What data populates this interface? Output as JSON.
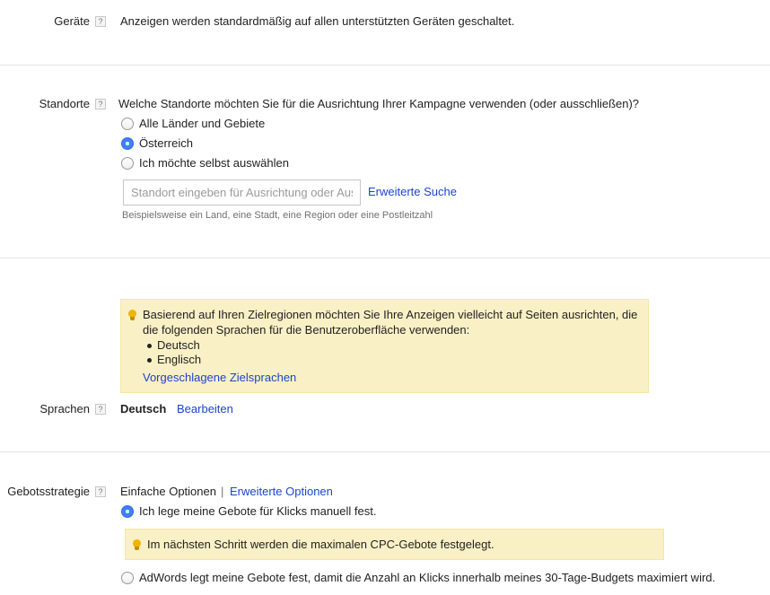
{
  "devices": {
    "label": "Geräte",
    "help": "?",
    "text": "Anzeigen werden standardmäßig auf allen unterstützten Geräten geschaltet."
  },
  "locations": {
    "label": "Standorte",
    "help": "?",
    "question": "Welche Standorte möchten Sie für die Ausrichtung Ihrer Kampagne verwenden (oder ausschließen)?",
    "options": [
      {
        "label": "Alle Länder und Gebiete",
        "checked": false
      },
      {
        "label": "Österreich",
        "checked": true
      },
      {
        "label": "Ich möchte selbst auswählen",
        "checked": false
      }
    ],
    "search_placeholder": "Standort eingeben für Ausrichtung oder Ausschluss",
    "advanced_search": "Erweiterte Suche",
    "hint": "Beispielsweise ein Land, eine Stadt, eine Region oder eine Postleitzahl"
  },
  "language_note": {
    "line1": "Basierend auf Ihren Zielregionen möchten Sie Ihre Anzeigen vielleicht auf Seiten ausrichten, die",
    "line2": "die folgenden Sprachen für die Benutzeroberfläche verwenden:",
    "languages": [
      "Deutsch",
      "Englisch"
    ],
    "link": "Vorgeschlagene Zielsprachen"
  },
  "languages": {
    "label": "Sprachen",
    "help": "?",
    "value": "Deutsch",
    "edit": "Bearbeiten"
  },
  "bidding": {
    "label": "Gebotsstrategie",
    "help": "?",
    "simple": "Einfache Optionen",
    "separator": "|",
    "advanced": "Erweiterte Optionen",
    "options": [
      {
        "label": "Ich lege meine Gebote für Klicks manuell fest.",
        "checked": true
      },
      {
        "label": "AdWords legt meine Gebote fest, damit die Anzahl an Klicks innerhalb meines 30-Tage-Budgets maximiert wird.",
        "checked": false
      }
    ],
    "note": "Im nächsten Schritt werden die maximalen CPC-Gebote festgelegt."
  },
  "colors": {
    "link": "#1a46c9",
    "note_background": "#faf0c5",
    "radio_selected": "#3b82f6"
  },
  "icons": {
    "help": "question-mark-icon",
    "bulb": "lightbulb-icon"
  }
}
